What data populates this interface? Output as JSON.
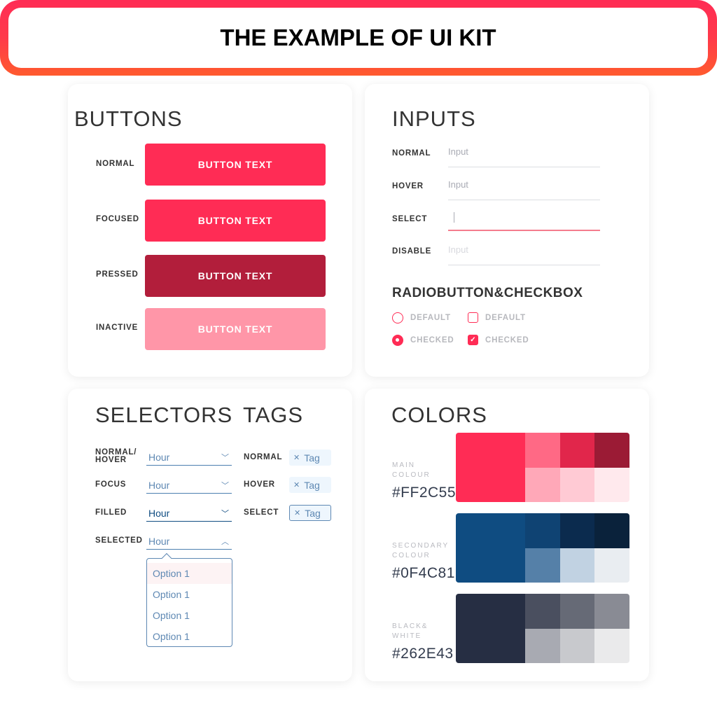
{
  "banner": {
    "title": "THE EXAMPLE OF UI KIT"
  },
  "buttons": {
    "title": "BUTTONS",
    "items": [
      {
        "state": "NORMAL",
        "label": "BUTTON TEXT",
        "color": "#FF2C55"
      },
      {
        "state": "FOCUSED",
        "label": "BUTTON TEXT",
        "color": "#FF2C55"
      },
      {
        "state": "PRESSED",
        "label": "BUTTON TEXT",
        "color": "#B21E3B"
      },
      {
        "state": "INACTIVE",
        "label": "BUTTON TEXT",
        "color": "#FF96A8"
      }
    ]
  },
  "inputs": {
    "title": "INPUTS",
    "items": [
      {
        "state": "NORMAL",
        "placeholder": "Input"
      },
      {
        "state": "HOVER",
        "placeholder": "Input"
      },
      {
        "state": "SELECT",
        "placeholder": ""
      },
      {
        "state": "DISABLE",
        "placeholder": "Input"
      }
    ],
    "rc_title": "RADIOBUTTON&CHECKBOX",
    "radio": [
      {
        "label": "DEFAULT",
        "checked": false
      },
      {
        "label": "CHECKED",
        "checked": true
      }
    ],
    "checkbox": [
      {
        "label": "DEFAULT",
        "checked": false
      },
      {
        "label": "CHECKED",
        "checked": true
      }
    ],
    "check_glyph": "✓"
  },
  "selectors": {
    "title": "SELECTORS",
    "items": [
      {
        "state_line1": "NORMAL/",
        "state_line2": "HOVER",
        "value": "Hour",
        "chevron": "﹀"
      },
      {
        "state_line1": "FOCUS",
        "value": "Hour",
        "chevron": "﹀"
      },
      {
        "state_line1": "FILLED",
        "value": "Hour",
        "chevron": "﹀"
      },
      {
        "state_line1": "SELECTED",
        "value": "Hour",
        "chevron": "︿"
      }
    ],
    "options": [
      "Option 1",
      "Option 1",
      "Option 1",
      "Option 1"
    ]
  },
  "tags": {
    "title": "TAGS",
    "items": [
      {
        "state": "NORMAL",
        "label": "Tag"
      },
      {
        "state": "HOVER",
        "label": "Tag"
      },
      {
        "state": "SELECT",
        "label": "Tag"
      }
    ],
    "close_glyph": "✕"
  },
  "colors": {
    "title": "COLORS",
    "palettes": [
      {
        "line1": "MAIN",
        "line2": "COLOUR",
        "hex": "#FF2C55",
        "main": "#FF2C55",
        "top": [
          "#FF6985",
          "#E1264B",
          "#9B1B35"
        ],
        "bottom": [
          "#FFA8B8",
          "#FFCAD4",
          "#FFE9ED"
        ]
      },
      {
        "line1": "SECONDARY",
        "line2": "COLOUR",
        "hex": "#0F4C81",
        "main": "#0F4C81",
        "top": [
          "#0F4373",
          "#0B2B4E",
          "#0A223B"
        ],
        "bottom": [
          "#5580A8",
          "#C1D2E2",
          "#E9EDF1"
        ]
      },
      {
        "line1": "BLACK&",
        "line2": "WHITE",
        "hex": "#262E43",
        "main": "#262E43",
        "top": [
          "#4A4F5F",
          "#666A76",
          "#898B94"
        ],
        "bottom": [
          "#A8AAB2",
          "#C8C9CD",
          "#EAEAEB"
        ]
      }
    ]
  }
}
